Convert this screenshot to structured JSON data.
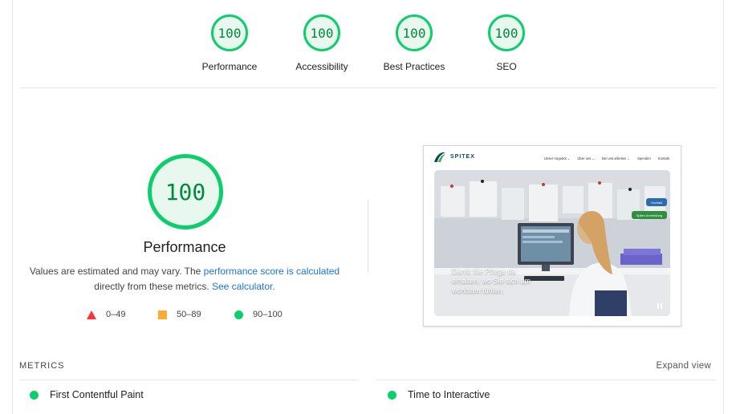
{
  "categories": [
    {
      "score": "100",
      "label": "Performance"
    },
    {
      "score": "100",
      "label": "Accessibility"
    },
    {
      "score": "100",
      "label": "Best Practices"
    },
    {
      "score": "100",
      "label": "SEO"
    }
  ],
  "performance": {
    "score": "100",
    "title": "Performance",
    "desc_part1": "Values are estimated and may vary. The ",
    "link_score": "performance score is calculated",
    "desc_part2": " directly from these metrics. ",
    "link_calc": "See calculator."
  },
  "legend": [
    {
      "icon": "triangle-icon",
      "range": "0–49",
      "color": "#ff3333"
    },
    {
      "icon": "square-icon",
      "range": "50–89",
      "color": "#ffaa33"
    },
    {
      "icon": "circle-icon",
      "range": "90–100",
      "color": "#0cce6b"
    }
  ],
  "screenshot": {
    "logo": "SPITEX",
    "nav": [
      "Unser Angebot ⌄",
      "Über uns ⌄",
      "Bei uns arbeiten ⌄",
      "Spenden",
      "Kontakt"
    ],
    "side_buttons": [
      "Kontakt",
      "Spitex Anmeldung"
    ],
    "hero_text": [
      "Damit Sie Pflege da",
      "erhalten, wo Sie sich am",
      "wohlsten fühlen."
    ]
  },
  "metrics": {
    "section_label": "METRICS",
    "expand_label": "Expand view",
    "items": [
      {
        "label": "First Contentful Paint",
        "status": "good"
      },
      {
        "label": "Time to Interactive",
        "status": "good"
      }
    ]
  },
  "colors": {
    "good": "#0cce6b",
    "average": "#ffaa33",
    "fail": "#ff3333",
    "link": "#1a73e8"
  }
}
